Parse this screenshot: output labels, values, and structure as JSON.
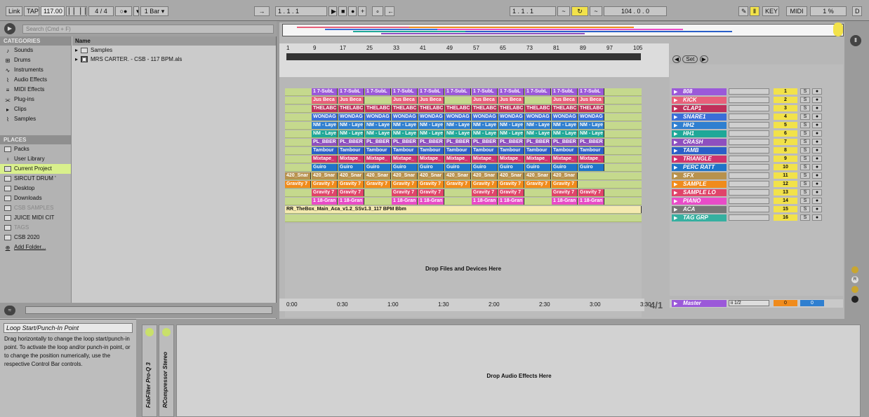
{
  "transport": {
    "link": "Link",
    "tap": "TAP",
    "tempo": "117.00",
    "sig": "4 / 4",
    "quant": "1 Bar ▾",
    "pos1": "1 .  1 .  1",
    "pos2": "1 .  1 .  1",
    "length": "104 .  0 .  0",
    "key": "KEY",
    "midi": "MIDI",
    "cpu": "1 %",
    "disk": "D"
  },
  "browser": {
    "search_placeholder": "Search (Cmd + F)",
    "categories_head": "CATEGORIES",
    "name_head": "Name",
    "places_head": "PLACES",
    "categories": [
      "Sounds",
      "Drums",
      "Instruments",
      "Audio Effects",
      "MIDI Effects",
      "Plug-ins",
      "Clips",
      "Samples"
    ],
    "places": [
      "Packs",
      "User Library",
      "Current Project",
      "SIRCUT DRUM '",
      "Desktop",
      "Downloads",
      "CSB SAMPLES",
      "JUICE MIDI CIT",
      "TAGS",
      "CSB 2020",
      "Add Folder..."
    ],
    "files": [
      "Samples",
      "MRS CARTER. - CSB - 117 BPM.als"
    ]
  },
  "info": {
    "title": "Loop Start/Punch-In Point",
    "text": "Drag horizontally to change the loop start/punch-in point. To activate the loop and/or punch-in point, or to change the position numerically, use the respective Control Bar controls."
  },
  "arrangement": {
    "bars": [
      "1",
      "9",
      "17",
      "25",
      "33",
      "41",
      "49",
      "57",
      "65",
      "73",
      "81",
      "89",
      "97",
      "105"
    ],
    "times": [
      "0:00",
      "0:30",
      "1:00",
      "1:30",
      "2:00",
      "2:30",
      "3:00",
      "3:30"
    ],
    "drop_files": "Drop Files and Devices Here",
    "set_label": "Set",
    "scale": "4/1",
    "full_clip": "RR_TheBox_Main_Aca_v1.2_SSv1.3_117 BPM Bbm"
  },
  "tracks": [
    {
      "name": "808",
      "num": "1",
      "color": "#9b59d9"
    },
    {
      "name": "KICK",
      "num": "2",
      "color": "#e8607a"
    },
    {
      "name": "CLAP1",
      "num": "3",
      "color": "#c0305a"
    },
    {
      "name": "SNARE1",
      "num": "4",
      "color": "#3a6ed8"
    },
    {
      "name": "HH2",
      "num": "5",
      "color": "#2f7fd0"
    },
    {
      "name": "HH1",
      "num": "6",
      "color": "#1fa898"
    },
    {
      "name": "CRASH",
      "num": "7",
      "color": "#8e4fbf"
    },
    {
      "name": "TAMB",
      "num": "8",
      "color": "#2a5fc8"
    },
    {
      "name": "TRIANGLE",
      "num": "9",
      "color": "#d0336c"
    },
    {
      "name": "PERC RATT",
      "num": "10",
      "color": "#1f74c9"
    },
    {
      "name": "SFX",
      "num": "11",
      "color": "#b8924d"
    },
    {
      "name": "SAMPLE",
      "num": "12",
      "color": "#f08b1c"
    },
    {
      "name": "SAMPLE LO",
      "num": "13",
      "color": "#e0446a"
    },
    {
      "name": "PIANO",
      "num": "14",
      "color": "#e84cc8"
    },
    {
      "name": "ACA",
      "num": "15",
      "color": "#777777"
    },
    {
      "name": "TAG GRP",
      "num": "16",
      "color": "#35b0a0"
    }
  ],
  "clip_labels": [
    "1 7-SubL",
    "Jus Beca",
    "THELABC",
    "WONDAG",
    "NM - Laye",
    "NM - Laye",
    "PL_BBER",
    "Tambour",
    "Mixtape_",
    "Guiro",
    "420_Snar",
    "Gravity 7",
    "Gravity 7",
    "1 18-Gran"
  ],
  "master": {
    "name": "Master",
    "io": "ii 1/2",
    "zero": "0"
  },
  "devices": {
    "dev1": "FabFilter Pro-Q 3",
    "dev2": "RCompressor Stereo",
    "drop_audio": "Drop Audio Effects Here"
  },
  "colors": {
    "clip_bg": "#c5d98d",
    "selected": "#d9f08c",
    "yellow": "#f2e24a"
  }
}
